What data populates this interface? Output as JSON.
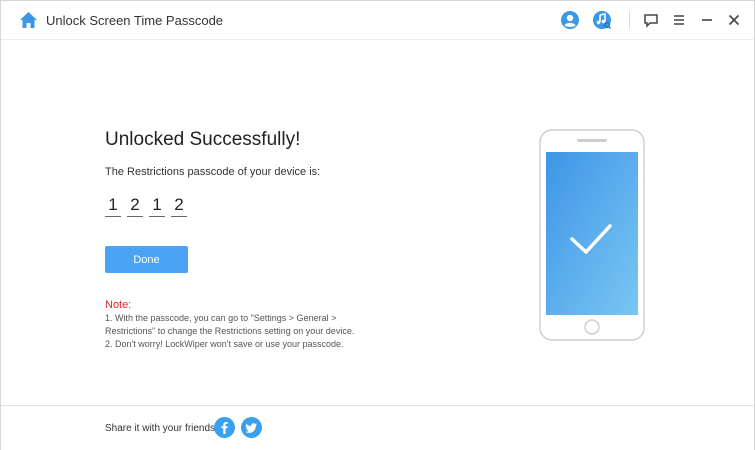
{
  "window": {
    "title": "Unlock Screen Time Passcode"
  },
  "toolbar": {
    "icons": [
      "home-icon",
      "user-icon",
      "music-search-icon",
      "feedback-icon",
      "menu-icon",
      "minimize-icon",
      "close-icon"
    ]
  },
  "result": {
    "heading": "Unlocked Successfully!",
    "description": "The Restrictions passcode of your device is:",
    "passcode_digits": [
      "1",
      "2",
      "1",
      "2"
    ],
    "done_label": "Done"
  },
  "note": {
    "title": "Note:",
    "lines": [
      "1. With the passcode, you can go to \"Settings > General >",
      "Restrictions\" to change the Restrictions setting on your device.",
      "2. Don't worry! LockWiper won't save or use your passcode."
    ]
  },
  "footer": {
    "share_label": "Share it with your friends:",
    "social": [
      "facebook-icon",
      "twitter-icon"
    ]
  },
  "colors": {
    "accent": "#4aa3f4",
    "note_red": "#e02424",
    "social_blue": "#3aa0ee"
  }
}
